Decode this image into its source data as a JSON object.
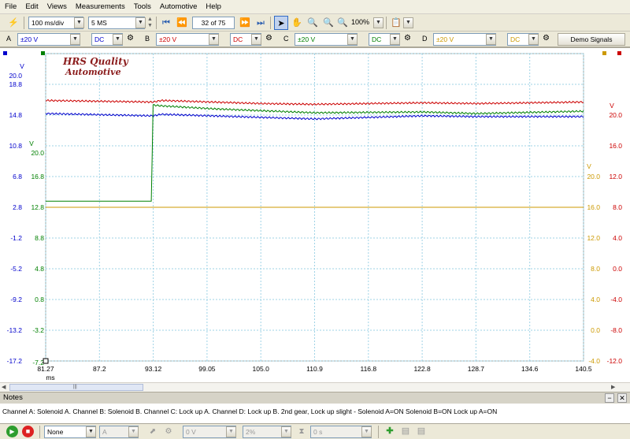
{
  "menu": [
    "File",
    "Edit",
    "Views",
    "Measurements",
    "Tools",
    "Automotive",
    "Help"
  ],
  "toolbar": {
    "timebase": "100 ms/div",
    "samples": "5 MS",
    "buffer": "32 of 75",
    "zoom": "100%"
  },
  "channels": [
    {
      "letter": "A",
      "range": "±20 V",
      "coupling": "DC",
      "color": "#0000cc"
    },
    {
      "letter": "B",
      "range": "±20 V",
      "coupling": "DC",
      "color": "#cc0000"
    },
    {
      "letter": "C",
      "range": "±20 V",
      "coupling": "DC",
      "color": "#008000"
    },
    {
      "letter": "D",
      "range": "±20 V",
      "coupling": "DC",
      "color": "#cc9900"
    }
  ],
  "demo_signals": "Demo Signals",
  "logo": {
    "line1": "HRS Quality",
    "line2": "Automotive"
  },
  "axes": {
    "a_unit": "V",
    "a_ticks": [
      "20.0",
      "18.8",
      "14.8",
      "10.8",
      "6.8",
      "2.8",
      "-1.2",
      "-5.2",
      "-9.2",
      "-13.2",
      "-17.2"
    ],
    "c_unit": "V",
    "c_ticks": [
      "20.0",
      "16.8",
      "12.8",
      "8.8",
      "4.8",
      "0.8",
      "-3.2",
      "-7.2"
    ],
    "b_unit": "V",
    "b_ticks": [
      "20.0",
      "16.0",
      "12.0",
      "8.0",
      "4.0",
      "0.0",
      "-4.0",
      "-8.0",
      "-12.0"
    ],
    "d_unit": "V",
    "d_ticks": [
      "20.0",
      "16.0",
      "12.0",
      "8.0",
      "4.0",
      "0.0",
      "-4.0"
    ],
    "x_ticks": [
      "81.27",
      "87.2",
      "93.12",
      "99.05",
      "105.0",
      "110.9",
      "116.8",
      "122.8",
      "128.7",
      "134.6",
      "140.5"
    ],
    "x_unit": "ms"
  },
  "chart_data": {
    "type": "line",
    "x_range": [
      81.27,
      140.5
    ],
    "x_unit": "ms",
    "series": [
      {
        "name": "A",
        "color": "#0000cc",
        "x": [
          81.27,
          93.12,
          94.0,
          105.0,
          110.9,
          122.8,
          128.7,
          140.5
        ],
        "y": [
          12.2,
          11.9,
          12.1,
          11.7,
          11.5,
          11.9,
          11.8,
          11.8
        ]
      },
      {
        "name": "B",
        "color": "#cc0000",
        "x": [
          81.27,
          93.12,
          94.0,
          105.0,
          110.9,
          122.8,
          128.7,
          140.5
        ],
        "y": [
          13.9,
          13.7,
          13.9,
          13.5,
          13.4,
          13.6,
          13.5,
          13.7
        ]
      },
      {
        "name": "C",
        "color": "#008000",
        "x": [
          81.27,
          92.9,
          93.1,
          94.0,
          100.0,
          110.9,
          122.8,
          128.7,
          140.5
        ],
        "y": [
          0.8,
          0.8,
          13.3,
          13.2,
          12.8,
          12.3,
          12.4,
          12.2,
          12.5
        ]
      },
      {
        "name": "D",
        "color": "#cc9900",
        "x": [
          81.27,
          140.5
        ],
        "y": [
          0.0,
          0.0
        ]
      }
    ]
  },
  "notes": {
    "title": "Notes",
    "text": "Channel A: Solenoid A.   Channel B: Solenoid B.   Channel C: Lock up A.   Channel D: Lock up B.        2nd gear, Lock up slight - Solenoid A=ON   Solenoid B=ON    Lock up A=ON"
  },
  "bottom": {
    "trigger_mode": "None",
    "trigger_channel": "A",
    "threshold": "0 V",
    "pretrigger": "2%",
    "delay": "0 s"
  }
}
